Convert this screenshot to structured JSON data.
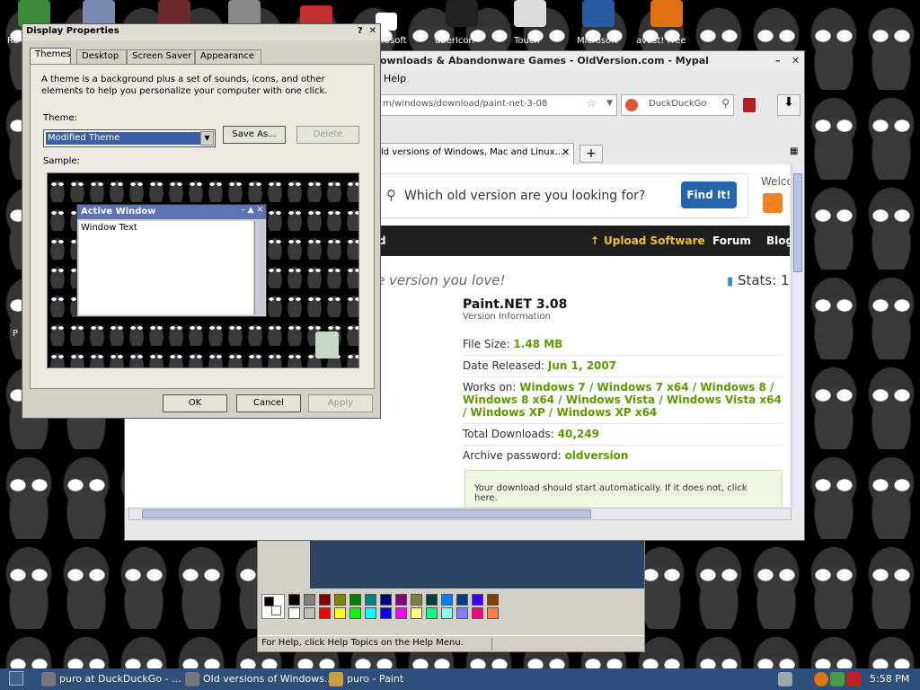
{
  "desktop": {
    "icons": [
      {
        "label": "Re",
        "color": "#3a8a3a"
      },
      {
        "label": "",
        "color": "#7a8ab0"
      },
      {
        "label": "",
        "color": "#6a2a2a"
      },
      {
        "label": "",
        "color": "#888888"
      },
      {
        "label": "",
        "color": "#c03030"
      },
      {
        "label": "rosoft",
        "color": "#ffffff"
      },
      {
        "label": "uberIcon",
        "color": "#222222"
      },
      {
        "label": "Touch",
        "color": "#dddddd"
      },
      {
        "label": "Microsoft",
        "color": "#2a5aa0"
      },
      {
        "label": "avast! Free",
        "color": "#e07010"
      }
    ],
    "left_letter": "P"
  },
  "paint": {
    "status_text": "For Help, click Help Topics on the Help Menu.",
    "palette": [
      "#000000",
      "#808080",
      "#800000",
      "#808000",
      "#008000",
      "#008080",
      "#000080",
      "#800080",
      "#808040",
      "#004040",
      "#0080ff",
      "#004080",
      "#4000ff",
      "#804000",
      "#ffffff",
      "#c0c0c0",
      "#ff0000",
      "#ffff00",
      "#00ff00",
      "#00ffff",
      "#0000ff",
      "#ff00ff",
      "#ffff80",
      "#00ff80",
      "#80ffff",
      "#8080ff",
      "#ff0080",
      "#ff8040"
    ]
  },
  "browser": {
    "title": "ownloads & Abandonware Games - OldVersion.com - Mypal",
    "menu_help": "Help",
    "url": "m/windows/download/paint-net-3-08",
    "search_engine": "DuckDuckGo",
    "tab_title": "ld versions of Windows, Mac and Linux...",
    "newtab_label": "+",
    "page": {
      "search_placeholder": "Which old version are you looking for?",
      "find_button": "Find It!",
      "welcome": "Welco",
      "nav_left": "d",
      "nav_upload": "Upload Software",
      "nav_forum": "Forum",
      "nav_blog": "Blog",
      "tagline": "e version you love!",
      "stats": "Stats: 1",
      "app_title": "Paint.NET 3.08",
      "app_subtitle": "Version Information",
      "file_size_label": "File Size:",
      "file_size": "1.48 MB",
      "date_label": "Date Released:",
      "date": "Jun 1, 2007",
      "works_label": "Works on:",
      "works_on": "Windows 7 / Windows 7 x64 / Windows 8 / Windows 8 x64 / Windows Vista / Windows Vista x64 / Windows XP / Windows XP x64",
      "downloads_label": "Total Downloads:",
      "downloads": "40,249",
      "password_label": "Archive password:",
      "password": "oldversion",
      "download_msg": "Your download should start automatically. If it does not,  click here."
    }
  },
  "dialog": {
    "title": "Display Properties",
    "tabs": [
      "Themes",
      "Desktop",
      "Screen Saver",
      "Appearance"
    ],
    "description": "A theme is a background plus a set of sounds, icons, and other elements to help you personalize your computer with one click.",
    "theme_label": "Theme:",
    "theme_value": "Modified Theme",
    "save_as": "Save As...",
    "delete": "Delete",
    "sample_label": "Sample:",
    "active_window_title": "Active Window",
    "window_text": "Window Text",
    "ok": "OK",
    "cancel": "Cancel",
    "apply": "Apply"
  },
  "taskbar": {
    "tasks": [
      {
        "label": "puro at DuckDuckGo - ...",
        "color": "#777777"
      },
      {
        "label": "Old versions of Windows...",
        "color": "#777777"
      },
      {
        "label": "puro - Paint",
        "color": "#c8a040"
      }
    ],
    "clock": "5:58 PM"
  }
}
